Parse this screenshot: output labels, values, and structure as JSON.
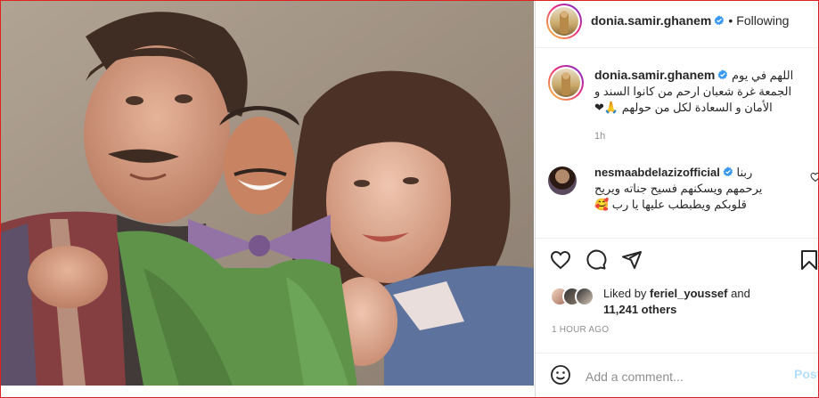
{
  "post": {
    "username": "donia.samir.ghanem",
    "follow_status": "Following",
    "separator": "•",
    "caption_lines": [
      "اللهم في يوم",
      "الجمعة غرة شعبان ارحم من كانوا السند و",
      "الأمان و السعادة لكل من حولهم 🙏❤"
    ],
    "caption_time": "1h"
  },
  "comment": {
    "username": "nesmaabdelazizofficial",
    "lines": [
      "ربنا",
      "يرحمهم ويسكنهم فسيح جناته ويريح",
      "قلوبكم ويطبطب عليها يا رب 🥰"
    ]
  },
  "likes": {
    "prefix": "Liked by",
    "user": "feriel_youssef",
    "and": "and",
    "count": "11,241 others"
  },
  "post_time": "1 HOUR AGO",
  "composer": {
    "placeholder": "Add a comment...",
    "post_label": "Post"
  },
  "icons": [
    "heart-icon",
    "comment-icon",
    "share-icon",
    "bookmark-icon",
    "emoji-icon",
    "verified-badge-icon",
    "like-comment-icon"
  ],
  "colors": {
    "verified": "#3897f0",
    "link": "#0095f6",
    "post_disabled": "#b2dffc",
    "muted": "#8e8e8e"
  }
}
